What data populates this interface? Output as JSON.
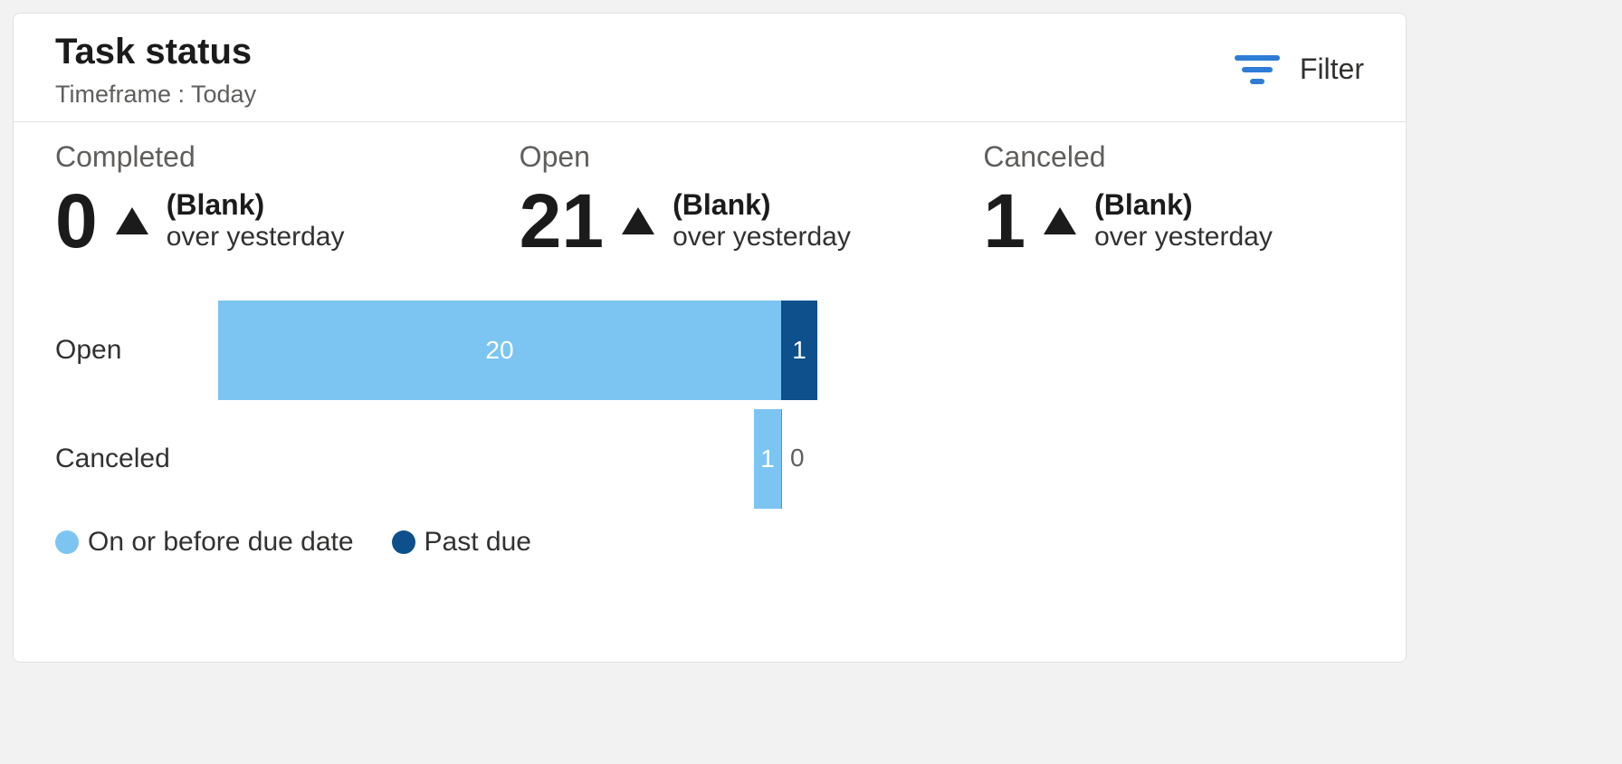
{
  "header": {
    "title": "Task status",
    "subtitle": "Timeframe : Today",
    "filter_label": "Filter"
  },
  "kpis": [
    {
      "label": "Completed",
      "value": "0",
      "delta_value": "(Blank)",
      "delta_sub": "over yesterday"
    },
    {
      "label": "Open",
      "value": "21",
      "delta_value": "(Blank)",
      "delta_sub": "over yesterday"
    },
    {
      "label": "Canceled",
      "value": "1",
      "delta_value": "(Blank)",
      "delta_sub": "over yesterday"
    }
  ],
  "legend": {
    "on": "On or before due date",
    "past": "Past due"
  },
  "chart_data": {
    "type": "bar",
    "orientation": "horizontal",
    "stacked": true,
    "categories": [
      "Open",
      "Canceled"
    ],
    "series": [
      {
        "name": "On or before due date",
        "color": "#7cc5f2",
        "values": [
          20,
          1
        ]
      },
      {
        "name": "Past due",
        "color": "#0d508c",
        "values": [
          1,
          0
        ]
      }
    ],
    "xlim": [
      0,
      21
    ],
    "title": "",
    "xlabel": "",
    "ylabel": ""
  },
  "chart_labels": {
    "row0_cat": "Open",
    "row0_on": "20",
    "row0_past": "1",
    "row1_cat": "Canceled",
    "row1_on": "1",
    "row1_past": "0"
  }
}
